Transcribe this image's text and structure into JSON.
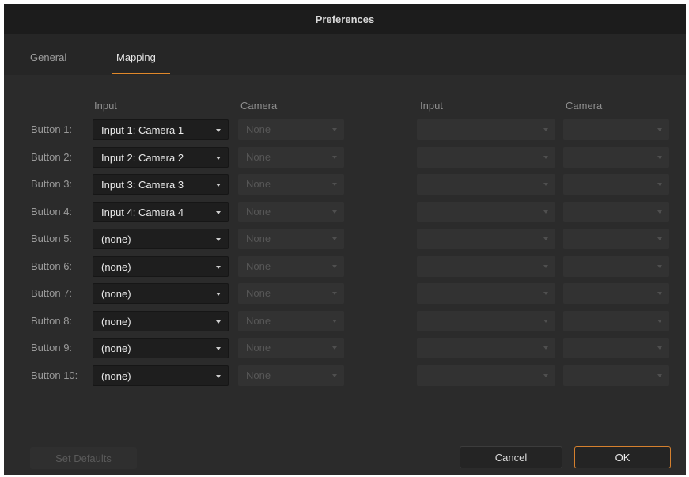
{
  "window": {
    "title": "Preferences"
  },
  "tabs": [
    {
      "label": "General",
      "active": false
    },
    {
      "label": "Mapping",
      "active": true
    }
  ],
  "headers": {
    "left_input": "Input",
    "left_camera": "Camera",
    "right_input": "Input",
    "right_camera": "Camera"
  },
  "rows": [
    {
      "label": "Button 1:",
      "input": "Input 1: Camera 1",
      "camera": "None",
      "right_input": "",
      "right_camera": ""
    },
    {
      "label": "Button 2:",
      "input": "Input 2: Camera 2",
      "camera": "None",
      "right_input": "",
      "right_camera": ""
    },
    {
      "label": "Button 3:",
      "input": "Input 3: Camera 3",
      "camera": "None",
      "right_input": "",
      "right_camera": ""
    },
    {
      "label": "Button 4:",
      "input": "Input 4: Camera 4",
      "camera": "None",
      "right_input": "",
      "right_camera": ""
    },
    {
      "label": "Button 5:",
      "input": "(none)",
      "camera": "None",
      "right_input": "",
      "right_camera": ""
    },
    {
      "label": "Button 6:",
      "input": "(none)",
      "camera": "None",
      "right_input": "",
      "right_camera": ""
    },
    {
      "label": "Button 7:",
      "input": "(none)",
      "camera": "None",
      "right_input": "",
      "right_camera": ""
    },
    {
      "label": "Button 8:",
      "input": "(none)",
      "camera": "None",
      "right_input": "",
      "right_camera": ""
    },
    {
      "label": "Button 9:",
      "input": "(none)",
      "camera": "None",
      "right_input": "",
      "right_camera": ""
    },
    {
      "label": "Button 10:",
      "input": "(none)",
      "camera": "None",
      "right_input": "",
      "right_camera": ""
    }
  ],
  "footer": {
    "set_defaults_label": "Set Defaults",
    "cancel_label": "Cancel",
    "ok_label": "OK"
  },
  "colors": {
    "accent": "#e0882a",
    "background": "#2b2b2b",
    "titlebar": "#1c1c1c"
  }
}
